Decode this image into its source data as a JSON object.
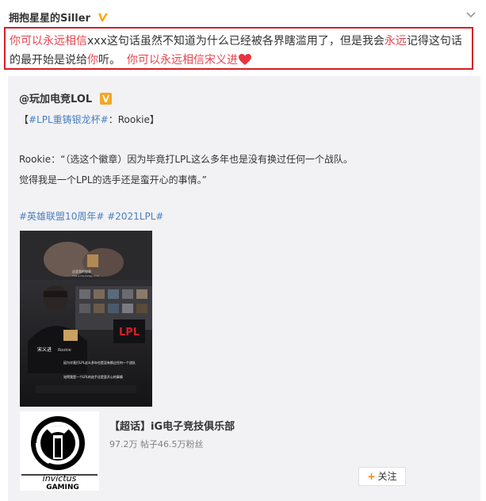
{
  "post": {
    "author": "拥抱星星的Siller",
    "text_1": "你可以永远相信",
    "text_2": "xxx这句话虽然不知道为什么已经被各界瞎滥用了，但是我会",
    "text_3": "永远",
    "text_4": "记得这句话的最开始是说给",
    "text_5": "你",
    "text_6": "听。",
    "text_7": "你可以永远相信宋义进",
    "colors": {
      "highlight": "#e6454f",
      "border": "#d31f26",
      "verified_badge": "#ffa500",
      "link": "#4a7fbf"
    }
  },
  "repost": {
    "author": "@玩加电竞LOL",
    "topic_open": "【",
    "topic": "#LPL重铸银龙杯#",
    "topic_close": "：Rookie】",
    "line_1": "Rookie：“（选这个徽章）因为毕竟打LPL这么多年也是没有换过任何一个战队。",
    "line_2": "觉得我是一个LPL的选手还是蛮开心的事情。”",
    "tags": "#英雄联盟10周年# #2021LPL#",
    "video_caption_1": "这是我的徽章",
    "video_caption_2": "This is the badge of IG",
    "video_watermark": "LPL",
    "video_name": "宋义进",
    "video_name_en": "Rookie",
    "video_sub_1": "因为毕竟打LPL这么多年也是没有换过任何一个战队",
    "video_sub_2": "觉得我是一个LPL的选手还是蛮开心的事情"
  },
  "card": {
    "title": "【超话】iG电子竞技俱乐部",
    "meta": "97.2万  帖子46.5万粉丝",
    "follow_label": "关注",
    "logo_text": "invictus GAMING"
  }
}
